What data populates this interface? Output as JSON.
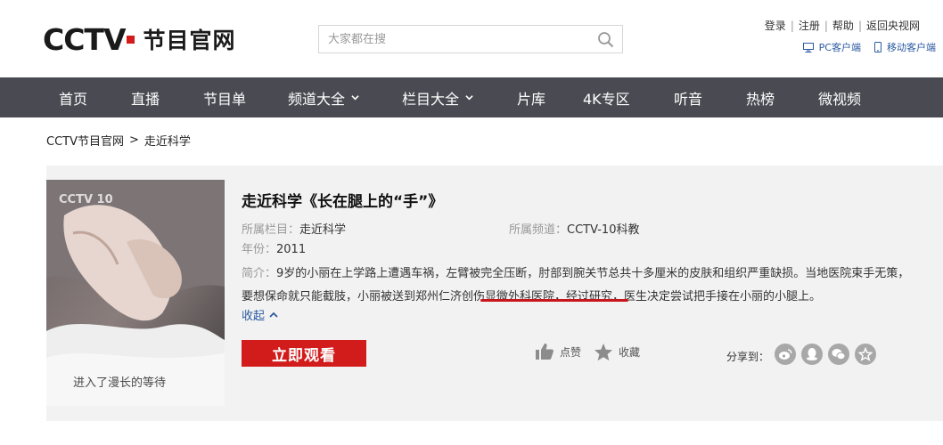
{
  "header": {
    "logo_text": "CCTV",
    "logo_subtitle": "节目官网",
    "search_placeholder": "大家都在搜",
    "top_links": [
      "登录",
      "注册",
      "帮助",
      "返回央视网"
    ],
    "clients": [
      "PC客户端",
      "移动客户端"
    ]
  },
  "nav": {
    "items": [
      {
        "label": "首页",
        "dropdown": false
      },
      {
        "label": "直播",
        "dropdown": false
      },
      {
        "label": "节目单",
        "dropdown": false
      },
      {
        "label": "频道大全",
        "dropdown": true
      },
      {
        "label": "栏目大全",
        "dropdown": true
      },
      {
        "label": "片库",
        "dropdown": false
      },
      {
        "label": "4K专区",
        "dropdown": false
      },
      {
        "label": "听音",
        "dropdown": false
      },
      {
        "label": "热榜",
        "dropdown": false
      },
      {
        "label": "微视频",
        "dropdown": false
      }
    ]
  },
  "breadcrumb": {
    "root": "CCTV节目官网",
    "separator": ">",
    "current": "走近科学"
  },
  "video": {
    "title": "走近科学《长在腿上的“手”》",
    "column_label": "所属栏目：",
    "column_value": "走近科学",
    "channel_label": "所属频道：",
    "channel_value": "CCTV-10科教",
    "year_label": "年份：",
    "year_value": "2011",
    "desc_label": "简介：",
    "desc_before": "9岁的小丽在上学路上遭遇车祸，左臂被完全压断，肘部到腕关节总共十多厘米的皮肤和组织严重缺损。当地医院束手无策，要想保命就只能截肢，小丽被送到",
    "desc_highlight": "郑州仁济创伤显微外科医院",
    "desc_after": "，经过研究，医生决定尝试把手接在小丽的小腿上。",
    "collapse_label": "收起",
    "watch_label": "立即观看",
    "like_label": "点赞",
    "favorite_label": "收藏",
    "share_label": "分享到：",
    "share_icons": [
      "weibo-icon",
      "qq-icon",
      "wechat-icon",
      "qzone-icon"
    ],
    "thumb_caption": "进入了漫长的等待",
    "thumb_channel_logo": "CCTV 10"
  },
  "colors": {
    "nav_bg": "#4a4b52",
    "brand_red": "#d21c1c",
    "link_blue": "#2c5aa0",
    "card_bg": "#f2f2f2"
  }
}
